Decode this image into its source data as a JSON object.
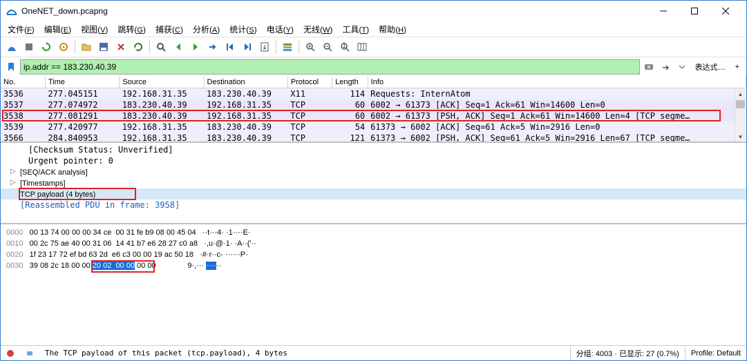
{
  "window": {
    "title": "OneNET_down.pcapng"
  },
  "menu": [
    {
      "label": "文件",
      "key": "F"
    },
    {
      "label": "编辑",
      "key": "E"
    },
    {
      "label": "视图",
      "key": "V"
    },
    {
      "label": "跳转",
      "key": "G"
    },
    {
      "label": "捕获",
      "key": "C"
    },
    {
      "label": "分析",
      "key": "A"
    },
    {
      "label": "统计",
      "key": "S"
    },
    {
      "label": "电话",
      "key": "Y"
    },
    {
      "label": "无线",
      "key": "W"
    },
    {
      "label": "工具",
      "key": "T"
    },
    {
      "label": "帮助",
      "key": "H"
    }
  ],
  "filter": {
    "value": "ip.addr == 183.230.40.39",
    "expr_btn": "表达式…",
    "plus": "+"
  },
  "packet_columns": [
    "No.",
    "Time",
    "Source",
    "Destination",
    "Protocol",
    "Length",
    "Info"
  ],
  "packet_widths": [
    60,
    100,
    114,
    113,
    60,
    48,
    510
  ],
  "packets": [
    {
      "no": "3536",
      "time": "277.045151",
      "src": "192.168.31.35",
      "dst": "183.230.40.39",
      "proto": "X11",
      "len": "114",
      "info": "Requests: InternAtom",
      "cls": "row-light"
    },
    {
      "no": "3537",
      "time": "277.074972",
      "src": "183.230.40.39",
      "dst": "192.168.31.35",
      "proto": "TCP",
      "len": "60",
      "info": "6002 → 61373 [ACK] Seq=1 Ack=61 Win=14600 Len=0",
      "cls": "row-sel"
    },
    {
      "no": "3538",
      "time": "277.081291",
      "src": "183.230.40.39",
      "dst": "192.168.31.35",
      "proto": "TCP",
      "len": "60",
      "info": "6002 → 61373 [PSH, ACK] Seq=1 Ack=61 Win=14600 Len=4 [TCP segme…",
      "cls": "row-sel",
      "hl": true
    },
    {
      "no": "3539",
      "time": "277.420977",
      "src": "192.168.31.35",
      "dst": "183.230.40.39",
      "proto": "TCP",
      "len": "54",
      "info": "61373 → 6002 [ACK] Seq=61 Ack=5 Win=2916 Len=0",
      "cls": "row-light"
    },
    {
      "no": "3566",
      "time": "284.840953",
      "src": "192.168.31.35",
      "dst": "183.230.40.39",
      "proto": "TCP",
      "len": "121",
      "info": "61373 → 6002 [PSH, ACK] Seq=61 Ack=5 Win=2916 Len=67 [TCP segme…",
      "cls": "row-light"
    }
  ],
  "tree": {
    "checksum": "[Checksum Status: Unverified]",
    "urgent": "Urgent pointer: 0",
    "seqack": "[SEQ/ACK analysis]",
    "timestamps": "[Timestamps]",
    "payload": "TCP payload (4 bytes)",
    "reassembled": "[Reassembled PDU in frame: 3958]"
  },
  "hex": {
    "rows": [
      {
        "off": "0000",
        "b": "00 13 74 00 00 00 34 ce  00 31 fe b9 08 00 45 04",
        "a": "··t···4· ·1····E·"
      },
      {
        "off": "0010",
        "b": "00 2c 75 ae 40 00 31 06  14 41 b7 e6 28 27 c0 a8",
        "a": "·,u·@·1· ·A··('··"
      },
      {
        "off": "0020",
        "b": "1f 23 17 72 ef bd 63 2d  e6 c3 00 00 19 ac 50 18",
        "a": "·#·r··c- ······P·"
      },
      {
        "off": "0030",
        "b1": "39 08 2c 18 00 00 ",
        "sel": "20 02  00 00",
        "b2": " 00 00",
        "a1": "9·,··· ",
        "asel": "····",
        "a2": "··"
      }
    ]
  },
  "status": {
    "hint": "The TCP payload of this packet (tcp.payload), 4 bytes",
    "pkts": "分组: 4003 · 已显示: 27 (0.7%)",
    "profile": "Profile: Default"
  },
  "icons": {
    "fin": "fin-icon",
    "folder": "folder-icon",
    "save": "save-icon",
    "close": "close-icon",
    "reload": "reload-icon",
    "find": "find-icon",
    "back": "back-icon",
    "fwd": "fwd-icon",
    "goto": "goto-icon",
    "first": "first-icon",
    "last": "last-icon",
    "autoscroll": "autoscroll-icon",
    "colorize": "colorize-icon",
    "zoomin": "zoomin-icon",
    "zoomout": "zoomout-icon",
    "zoom100": "zoom100-icon",
    "resize": "resize-icon",
    "restart": "restart-icon",
    "stop": "stop-icon",
    "options": "options-icon"
  }
}
